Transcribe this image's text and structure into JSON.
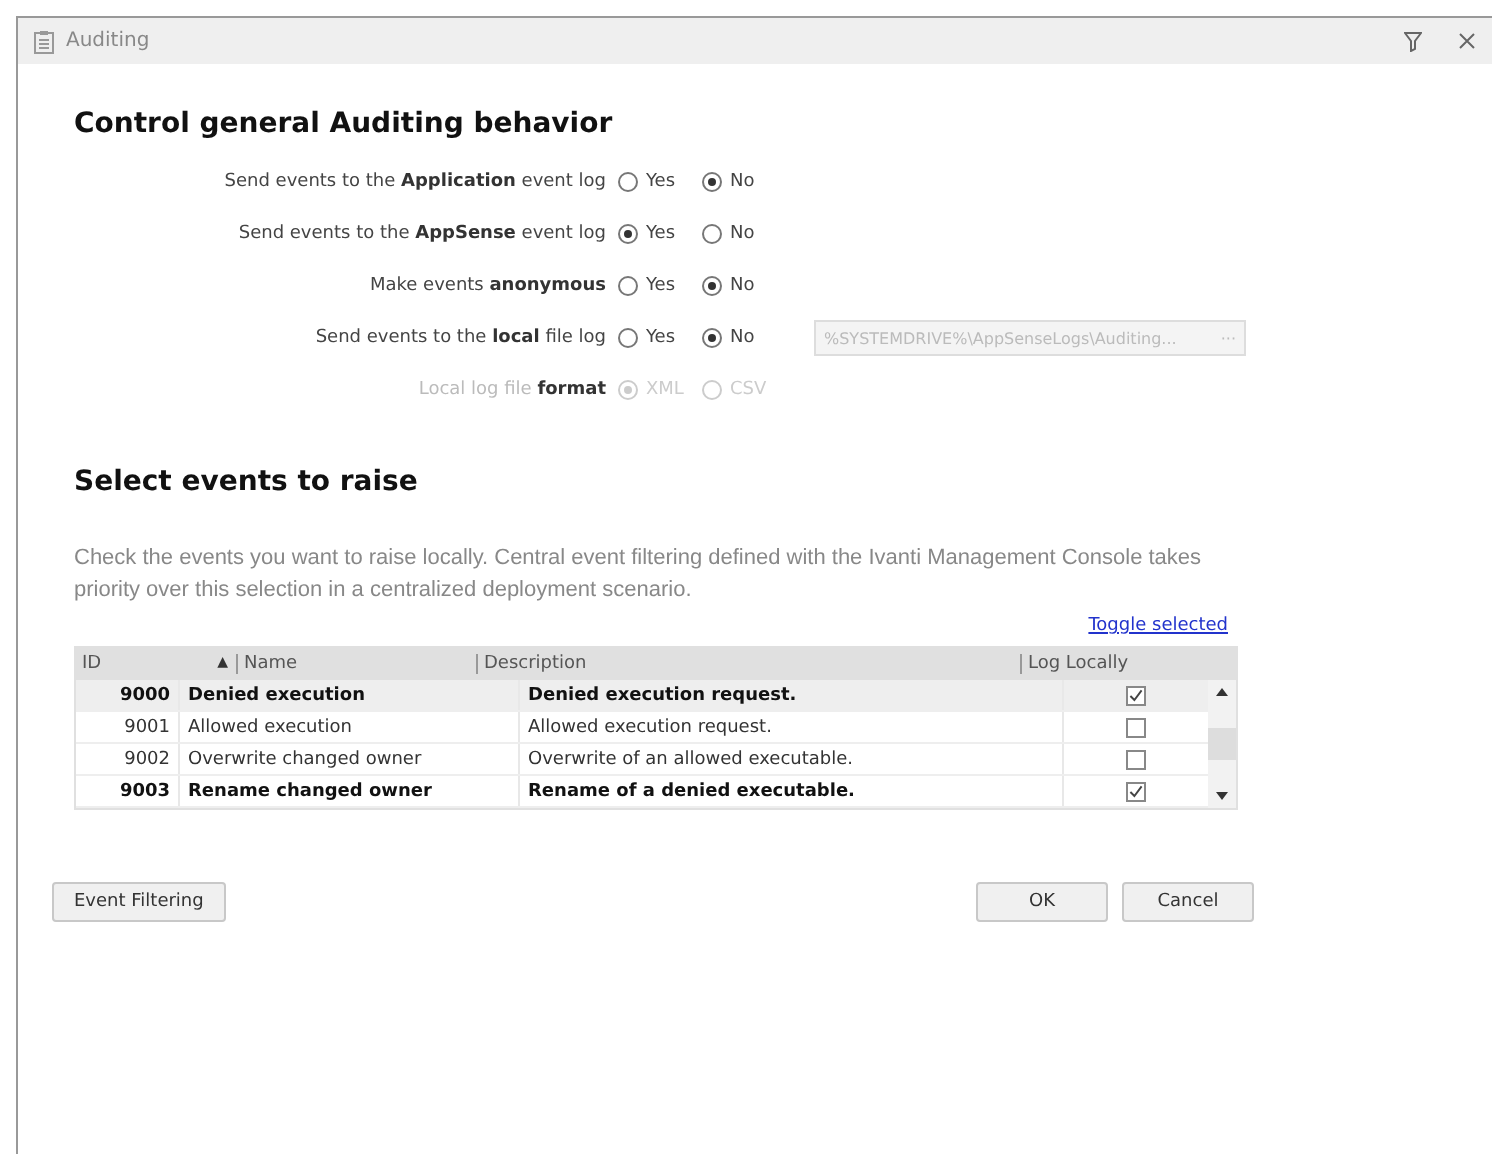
{
  "window": {
    "title": "Auditing"
  },
  "general": {
    "heading": "Control general Auditing behavior",
    "options": [
      {
        "label": "Send events to the **Application** event log",
        "disabled": false,
        "choices": [
          {
            "label": "Yes",
            "selected": false
          },
          {
            "label": "No",
            "selected": true
          }
        ]
      },
      {
        "label": "Send events to the **AppSense** event log",
        "disabled": false,
        "choices": [
          {
            "label": "Yes",
            "selected": true
          },
          {
            "label": "No",
            "selected": false
          }
        ]
      },
      {
        "label": "Make events **anonymous**",
        "disabled": false,
        "choices": [
          {
            "label": "Yes",
            "selected": false
          },
          {
            "label": "No",
            "selected": true
          }
        ]
      },
      {
        "label": "Send events to the **local** file log",
        "disabled": false,
        "choices": [
          {
            "label": "Yes",
            "selected": false
          },
          {
            "label": "No",
            "selected": true
          }
        ],
        "path": {
          "value": "%SYSTEMDRIVE%\\AppSenseLogs\\Auditing...",
          "button": "···",
          "disabled": true
        }
      },
      {
        "label": "Local log file **format**",
        "disabled": true,
        "choices": [
          {
            "label": "XML",
            "selected": true
          },
          {
            "label": "CSV",
            "selected": false
          }
        ]
      }
    ]
  },
  "events": {
    "heading": "Select events to raise",
    "description": "Check the events you want to raise locally. Central event filtering defined with the Ivanti Management Console takes priority over this selection in a centralized deployment scenario.",
    "toggle_link": "Toggle selected",
    "table": {
      "columns": [
        {
          "label": "ID",
          "sort_mark": "▲"
        },
        {
          "label": "Name"
        },
        {
          "label": "Description"
        },
        {
          "label": "Log Locally"
        }
      ],
      "rows": [
        {
          "id": "9000",
          "name": "Denied execution",
          "description": "Denied execution request.",
          "checked": true,
          "selected": true
        },
        {
          "id": "9001",
          "name": "Allowed execution",
          "description": "Allowed execution request.",
          "checked": false,
          "selected": false
        },
        {
          "id": "9002",
          "name": "Overwrite changed owner",
          "description": "Overwrite of an allowed executable.",
          "checked": false,
          "selected": false
        },
        {
          "id": "9003",
          "name": "Rename changed owner",
          "description": "Rename of a denied executable.",
          "checked": true,
          "selected": false
        }
      ]
    }
  },
  "buttons": {
    "left": "Event Filtering",
    "ok": "OK",
    "cancel": "Cancel"
  }
}
